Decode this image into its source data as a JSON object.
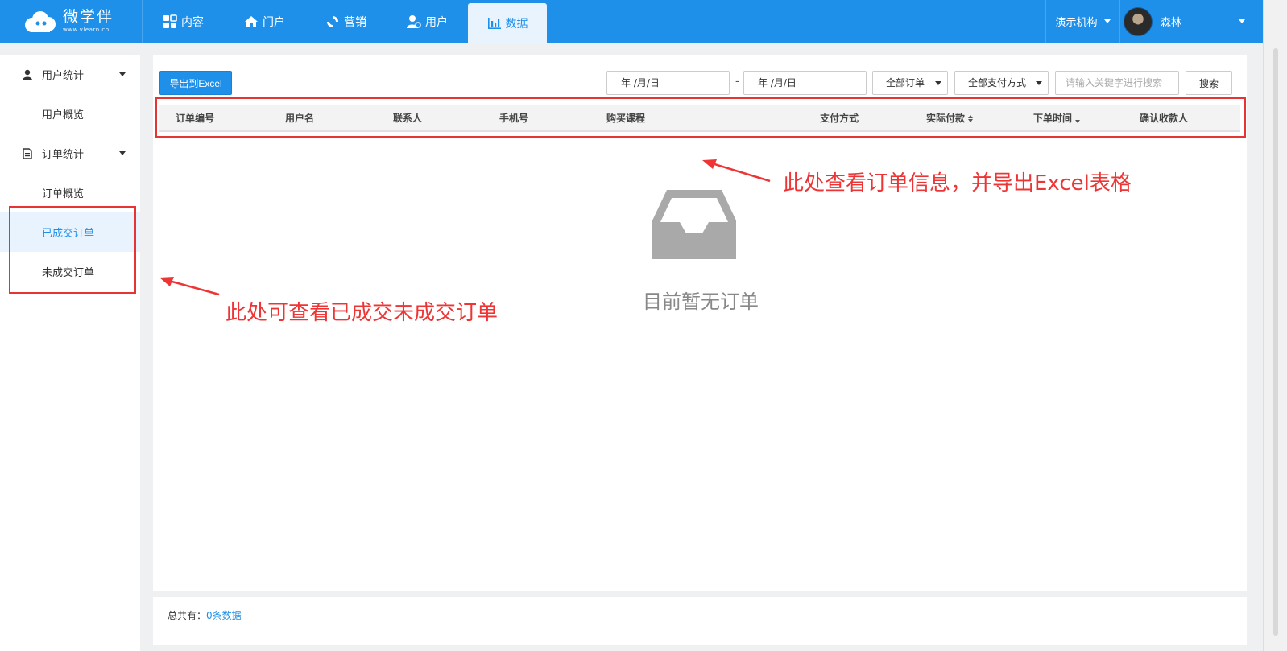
{
  "header": {
    "logo_text": "微学伴",
    "logo_url": "www.vlearn.cn",
    "nav": [
      {
        "label": "内容",
        "icon": "grid-icon"
      },
      {
        "label": "门户",
        "icon": "home-icon"
      },
      {
        "label": "营销",
        "icon": "refresh-icon"
      },
      {
        "label": "用户",
        "icon": "user-gear-icon"
      },
      {
        "label": "数据",
        "icon": "bar-chart-icon",
        "active": true
      }
    ],
    "org": "演示机构",
    "user_name": "森林"
  },
  "sidebar": {
    "groups": [
      {
        "label": "用户统计",
        "icon": "person-icon",
        "items": [
          "用户概览"
        ]
      },
      {
        "label": "订单统计",
        "icon": "document-icon",
        "items": [
          "订单概览",
          "已成交订单",
          "未成交订单"
        ]
      }
    ],
    "active_item": "已成交订单"
  },
  "toolbar": {
    "export_label": "导出到Excel",
    "date_start": "年 /月/日",
    "date_separator": "-",
    "date_end": "年 /月/日",
    "order_filter": "全部订单",
    "payment_filter": "全部支付方式",
    "search_placeholder": "请输入关键字进行搜索",
    "search_label": "搜索"
  },
  "table": {
    "columns": [
      "订单编号",
      "用户名",
      "联系人",
      "手机号",
      "购买课程",
      "支付方式",
      "实际付款",
      "下单时间",
      "确认收款人"
    ]
  },
  "empty": {
    "message": "目前暂无订单"
  },
  "annotations": {
    "table_note": "此处查看订单信息，并导出Excel表格",
    "sidebar_note": "此处可查看已成交未成交订单",
    "color": "#ee3535"
  },
  "footer": {
    "total_label": "总共有：",
    "total_count": "0条数据"
  },
  "colors": {
    "primary": "#1f90ea",
    "annotation": "#ee3535"
  }
}
